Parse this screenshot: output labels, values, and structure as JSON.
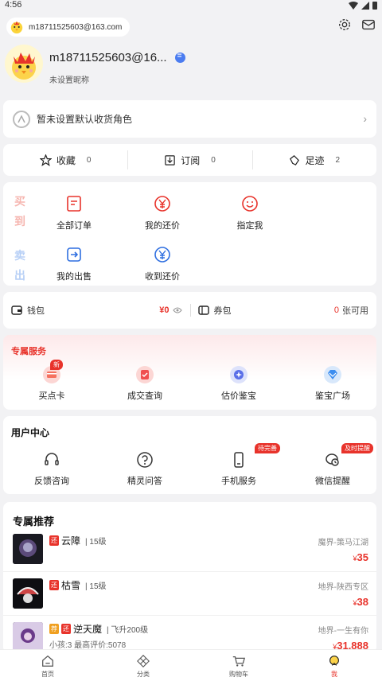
{
  "status": {
    "time": "4:56"
  },
  "header": {
    "email": "m18711525603@163.com"
  },
  "profile": {
    "nickname": "m18711525603@16...",
    "subtitle": "未设置昵称"
  },
  "address": {
    "text": "暂未设置默认收货角色"
  },
  "stats": [
    {
      "label": "收藏",
      "count": "0"
    },
    {
      "label": "订阅",
      "count": "0"
    },
    {
      "label": "足迹",
      "count": "2"
    }
  ],
  "orders": {
    "buy_tag": "买到",
    "sell_tag": "卖出",
    "buy_items": [
      "全部订单",
      "我的还价",
      "指定我"
    ],
    "sell_items": [
      "我的出售",
      "收到还价"
    ]
  },
  "wallet": {
    "wallet_label": "钱包",
    "wallet_amount": "¥0",
    "coupon_label": "券包",
    "coupon_count": "0",
    "coupon_suffix": "张可用"
  },
  "services": {
    "title": "专属服务",
    "items": [
      {
        "label": "买点卡",
        "tag": "新"
      },
      {
        "label": "成交查询"
      },
      {
        "label": "估价鉴宝"
      },
      {
        "label": "鉴宝广场"
      }
    ]
  },
  "user_center": {
    "title": "用户中心",
    "items": [
      {
        "label": "反馈咨询"
      },
      {
        "label": "精灵问答"
      },
      {
        "label": "手机服务",
        "tag": "待完善"
      },
      {
        "label": "微信提醒",
        "tag": "及时提醒"
      }
    ]
  },
  "recommendations": {
    "title": "专属推荐",
    "items": [
      {
        "tag": "还",
        "name": "云障",
        "level": "15级",
        "server": "魔界-策马江湖",
        "currency": "¥",
        "price": "35"
      },
      {
        "tag": "还",
        "name": "枯雪",
        "level": "15级",
        "server": "地界-陕西专区",
        "currency": "¥",
        "price": "38"
      },
      {
        "tag2": "荐",
        "tag": "还",
        "name": "逆天魔",
        "level": "飞升200级",
        "server": "地界-一生有你",
        "currency": "¥",
        "price": "31,888",
        "desc": "小孩:3 最高评价:5078"
      }
    ]
  },
  "tabbar": {
    "items": [
      {
        "label": "首页"
      },
      {
        "label": "分类"
      },
      {
        "label": "购物车"
      },
      {
        "label": "我"
      }
    ]
  },
  "colors": {
    "accent": "#e8332b",
    "blue": "#4b7cf0"
  }
}
